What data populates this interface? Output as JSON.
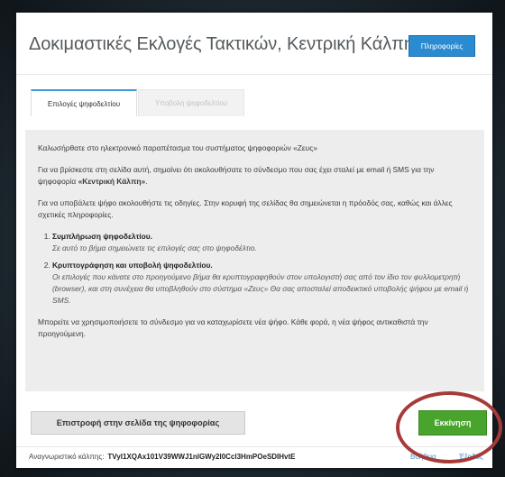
{
  "header": {
    "title": "Δοκιμαστικές Εκλογές Τακτικών, Κεντρική Κάλπη",
    "info_button": "Πληροφορίες"
  },
  "tabs": [
    {
      "label": "Επιλογές ψηφοδελτίου",
      "state": "active"
    },
    {
      "label": "Υποβολή ψηφοδελτίου",
      "state": "disabled"
    }
  ],
  "content": {
    "welcome": "Καλωσήρθατε στο ηλεκτρονικό παραπέτασμα του συστήματος ψηφοφοριών «Ζευς»",
    "para1_prefix": "Για να βρίσκεστε στη σελίδα αυτή, σημαίνει ότι ακολουθήσατε το σύνδεσμο που σας έχει σταλεί με email ή SMS για την ψηφοφορία ",
    "para1_bold": "«Κεντρική Κάλπη»",
    "para1_suffix": ".",
    "para2": "Για να υποβάλετε ψήφο ακολουθήστε τις οδηγίες. Στην κορυφή της σελίδας θα σημειώνεται η πρόοδός σας, καθώς και άλλες σχετικές πληροφορίες.",
    "steps": [
      {
        "title": "Συμπλήρωση ψηφοδελτίου.",
        "desc": "Σε αυτό το βήμα σημειώνετε τις επιλογές σας στο ψηφοδέλτιο."
      },
      {
        "title": "Κρυπτογράφηση και υποβολή ψηφοδελτίου.",
        "desc": "Οι επιλογές που κάνατε στο προηγούμενο βήμα θα κρυπτογραφηθούν στον υπολογιστή σας από τον ίδιο τον φυλλομετρητή (browser), και στη συνέχεια θα υποβληθούν στο σύστημα «Ζευς» Θα σας αποσταλεί αποδεικτικό υποβολής ψήφου με email ή SMS."
      }
    ],
    "para3": "Μπορείτε να χρησιμοποιήσετε το σύνδεσμο για να καταχωρίσετε νέα ψήφο. Κάθε φορά, η νέα ψήφος αντικαθιστά την προηγούμενη."
  },
  "buttons": {
    "back": "Επιστροφή στην σελίδα της ψηφοφορίας",
    "start": "Εκκίνηση"
  },
  "footer": {
    "label": "Αναγνωριστικό κάλπης:",
    "code": "TVyl1XQAx101V39WWJ1nlGWy2l0Ccl3HmPOeSDIHvtE",
    "help": "Βοήθεια",
    "link2": "Έξοδος"
  },
  "colors": {
    "accent_blue": "#2a8bd1",
    "start_green": "#49a42e",
    "highlight_circle": "#a63a38"
  }
}
